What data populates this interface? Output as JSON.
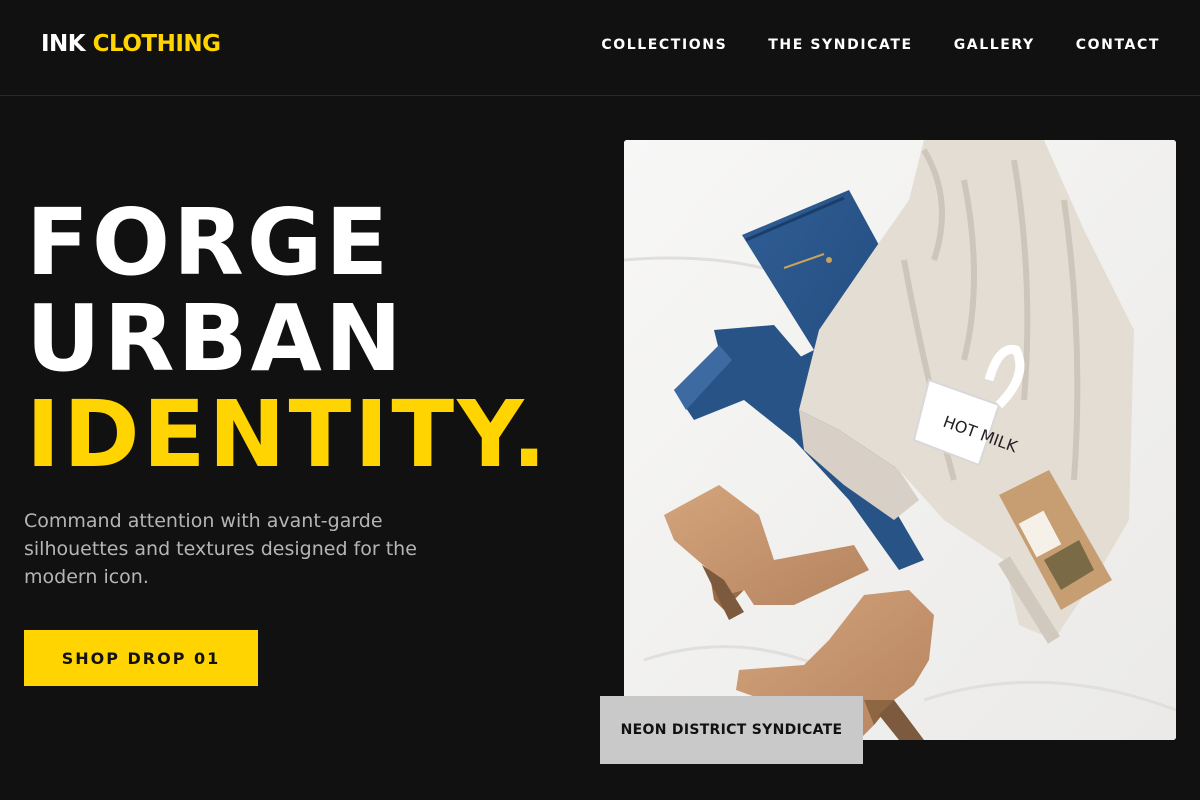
{
  "brand": {
    "name_part1": "INK",
    "name_part2": "CLOTHING",
    "accent_color": "#ffd400",
    "background_color": "#111111"
  },
  "nav": {
    "items": [
      {
        "label": "COLLECTIONS"
      },
      {
        "label": "THE SYNDICATE"
      },
      {
        "label": "GALLERY"
      },
      {
        "label": "CONTACT"
      }
    ]
  },
  "hero": {
    "headline_line1": "FORGE",
    "headline_line2": "URBAN",
    "headline_line3": "IDENTITY.",
    "subtext": "Command attention with avant-garde silhouettes and textures designed for the modern icon.",
    "cta_label": "SHOP DROP 01",
    "image_caption": "NEON DISTRICT SYNDICATE",
    "mug_text": "HOT MILK"
  }
}
